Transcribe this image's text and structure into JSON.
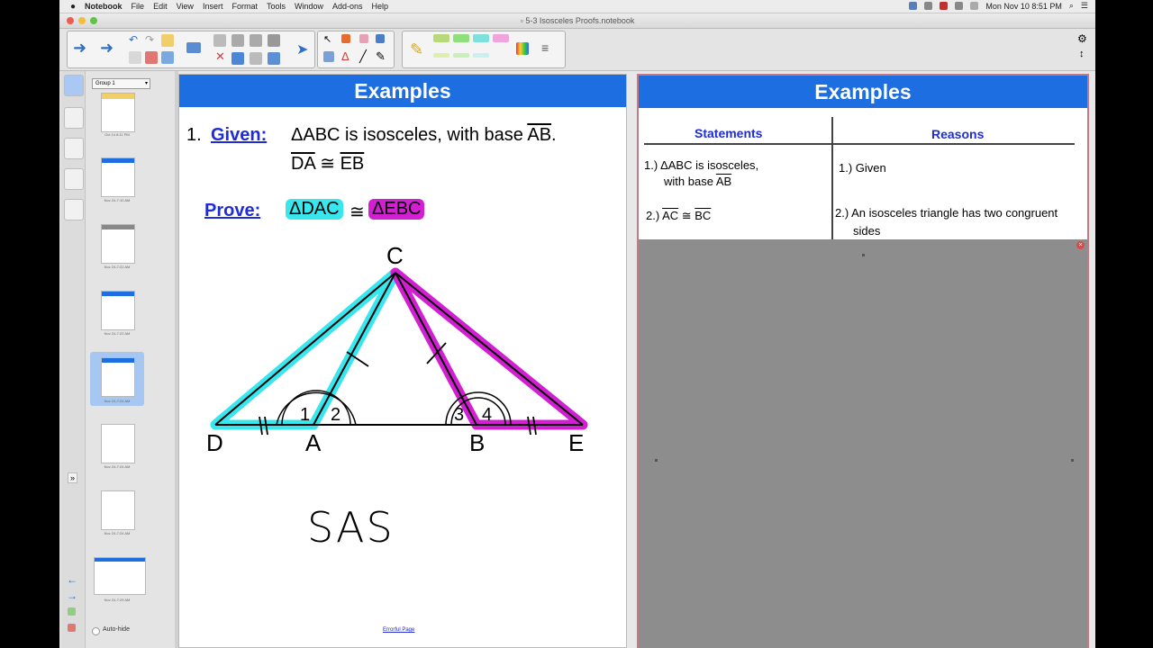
{
  "menubar": {
    "app": "Notebook",
    "items": [
      "File",
      "Edit",
      "View",
      "Insert",
      "Format",
      "Tools",
      "Window",
      "Add-ons",
      "Help"
    ],
    "clock": "Mon Nov 10  8:51 PM"
  },
  "window": {
    "title": "5-3 Isosceles Proofs.notebook"
  },
  "sidebar": {
    "group_label": "Group 1",
    "thumbs": [
      {
        "caption": "Oct 14 8:11 PM"
      },
      {
        "caption": "Nov 24-7:10 AM"
      },
      {
        "caption": "Nov 24-7:22 AM"
      },
      {
        "caption": "Nov 24-7:22 AM"
      },
      {
        "caption": "Nov 24-7:24 AM"
      },
      {
        "caption": "Nov 24-7:24 AM"
      },
      {
        "caption": "Nov 24-7:24 AM"
      },
      {
        "caption": "Nov 24-7:29 AM"
      }
    ],
    "autohide_label": "Auto-hide"
  },
  "left_page": {
    "banner": "Examples",
    "given_num": "1.",
    "given_label": "Given:",
    "given_line1_pre": "ΔABC is isosceles, with base ",
    "given_line1_seg": "AB",
    "given_line1_post": ".",
    "given_line2_a": "DA",
    "given_line2_op": " ≅ ",
    "given_line2_b": "EB",
    "prove_label": "Prove:",
    "prove_a": "ΔDAC",
    "prove_op": "≅",
    "prove_b": "ΔEBC",
    "diagram": {
      "vertex_C": "C",
      "vertex_D": "D",
      "vertex_A": "A",
      "vertex_B": "B",
      "vertex_E": "E",
      "angle_1": "1",
      "angle_2": "2",
      "angle_3": "3",
      "angle_4": "4"
    },
    "handwriting": "SAS",
    "footer_link": "Errorful Page"
  },
  "right_page": {
    "banner": "Examples",
    "col_statements": "Statements",
    "col_reasons": "Reasons",
    "rows": [
      {
        "stmt_a": "1.) ΔABC is isosceles,",
        "stmt_b": "with base ",
        "stmt_b_seg": "AB",
        "reason_a": "1.) Given",
        "reason_b": ""
      },
      {
        "stmt_a": "2.) ",
        "stmt_seg1": "AC",
        "stmt_op": " ≅ ",
        "stmt_seg2": "BC",
        "reason_a": "2.) An isosceles triangle has two congruent",
        "reason_b": "sides"
      }
    ]
  },
  "colors": {
    "banner_blue": "#1d6fe1",
    "cyan_highlight": "#38e6ee",
    "magenta_highlight": "#d21fd2",
    "link_blue": "#1f2bd8"
  }
}
